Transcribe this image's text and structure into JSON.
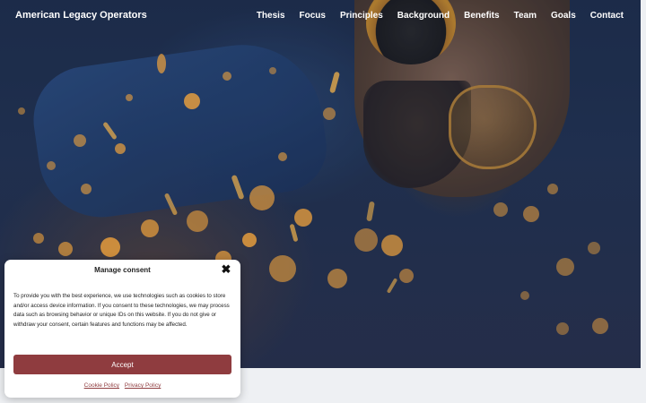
{
  "site": {
    "brand": "American Legacy Operators",
    "nav": [
      "Thesis",
      "Focus",
      "Principles",
      "Background",
      "Benefits",
      "Team",
      "Goals",
      "Contact"
    ]
  },
  "consent": {
    "title": "Manage consent",
    "body": "To provide you with the best experience, we use technologies such as cookies to store and/or access device information. If you consent to these technologies, we may process data such as browsing behavior or unique IDs on this website. If you do not give or withdraw your consent, certain features and functions may be affected.",
    "accept_label": "Accept",
    "cookie_policy_label": "Cookie Policy",
    "privacy_policy_label": "Privacy Policy",
    "close_icon": "close-icon"
  },
  "colors": {
    "accent": "#8f3c3f",
    "hero_overlay": "#233556",
    "spark": "#f0a33c"
  }
}
